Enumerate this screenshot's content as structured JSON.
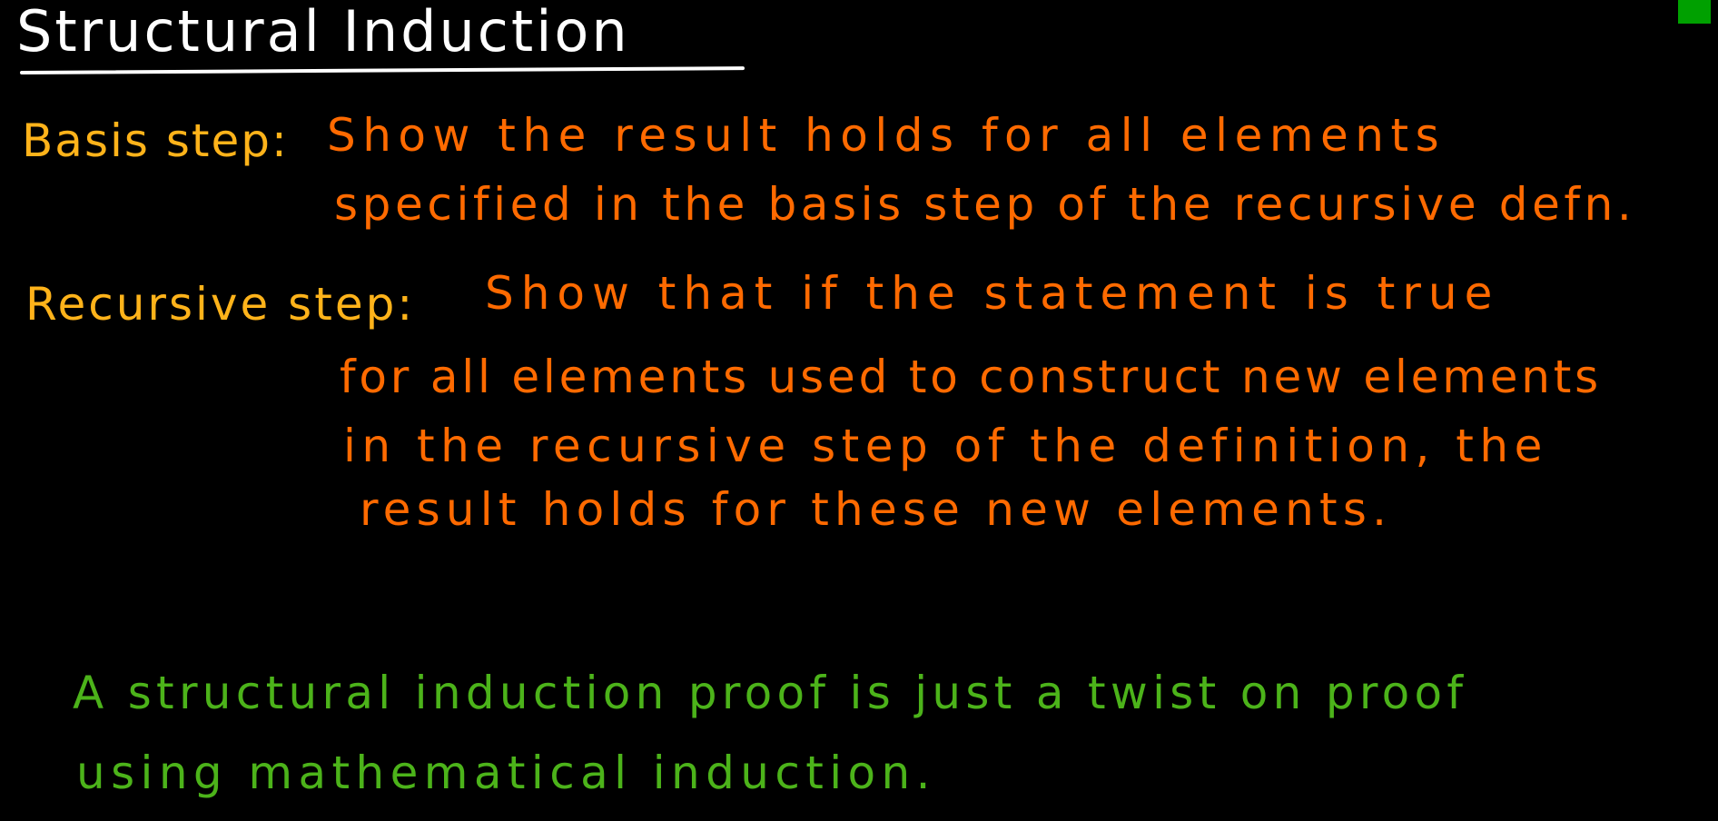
{
  "colors": {
    "background": "#000000",
    "title": "#ffffff",
    "label": "#ffb31a",
    "body": "#ff6a00",
    "note": "#4cb31a",
    "corner": "#00a000"
  },
  "title": "Structural Induction",
  "basis": {
    "label": "Basis step:",
    "lines": [
      "Show the result holds for all elements",
      "specified in the basis step of the recursive defn."
    ]
  },
  "recursive": {
    "label": "Recursive step:",
    "lines": [
      "Show that if the statement is true",
      "for all elements used to construct new elements",
      "in the recursive step of the definition, the",
      "result holds for these new elements."
    ]
  },
  "note": {
    "lines": [
      "A structural induction proof is just a twist on proof",
      "using mathematical induction."
    ]
  }
}
